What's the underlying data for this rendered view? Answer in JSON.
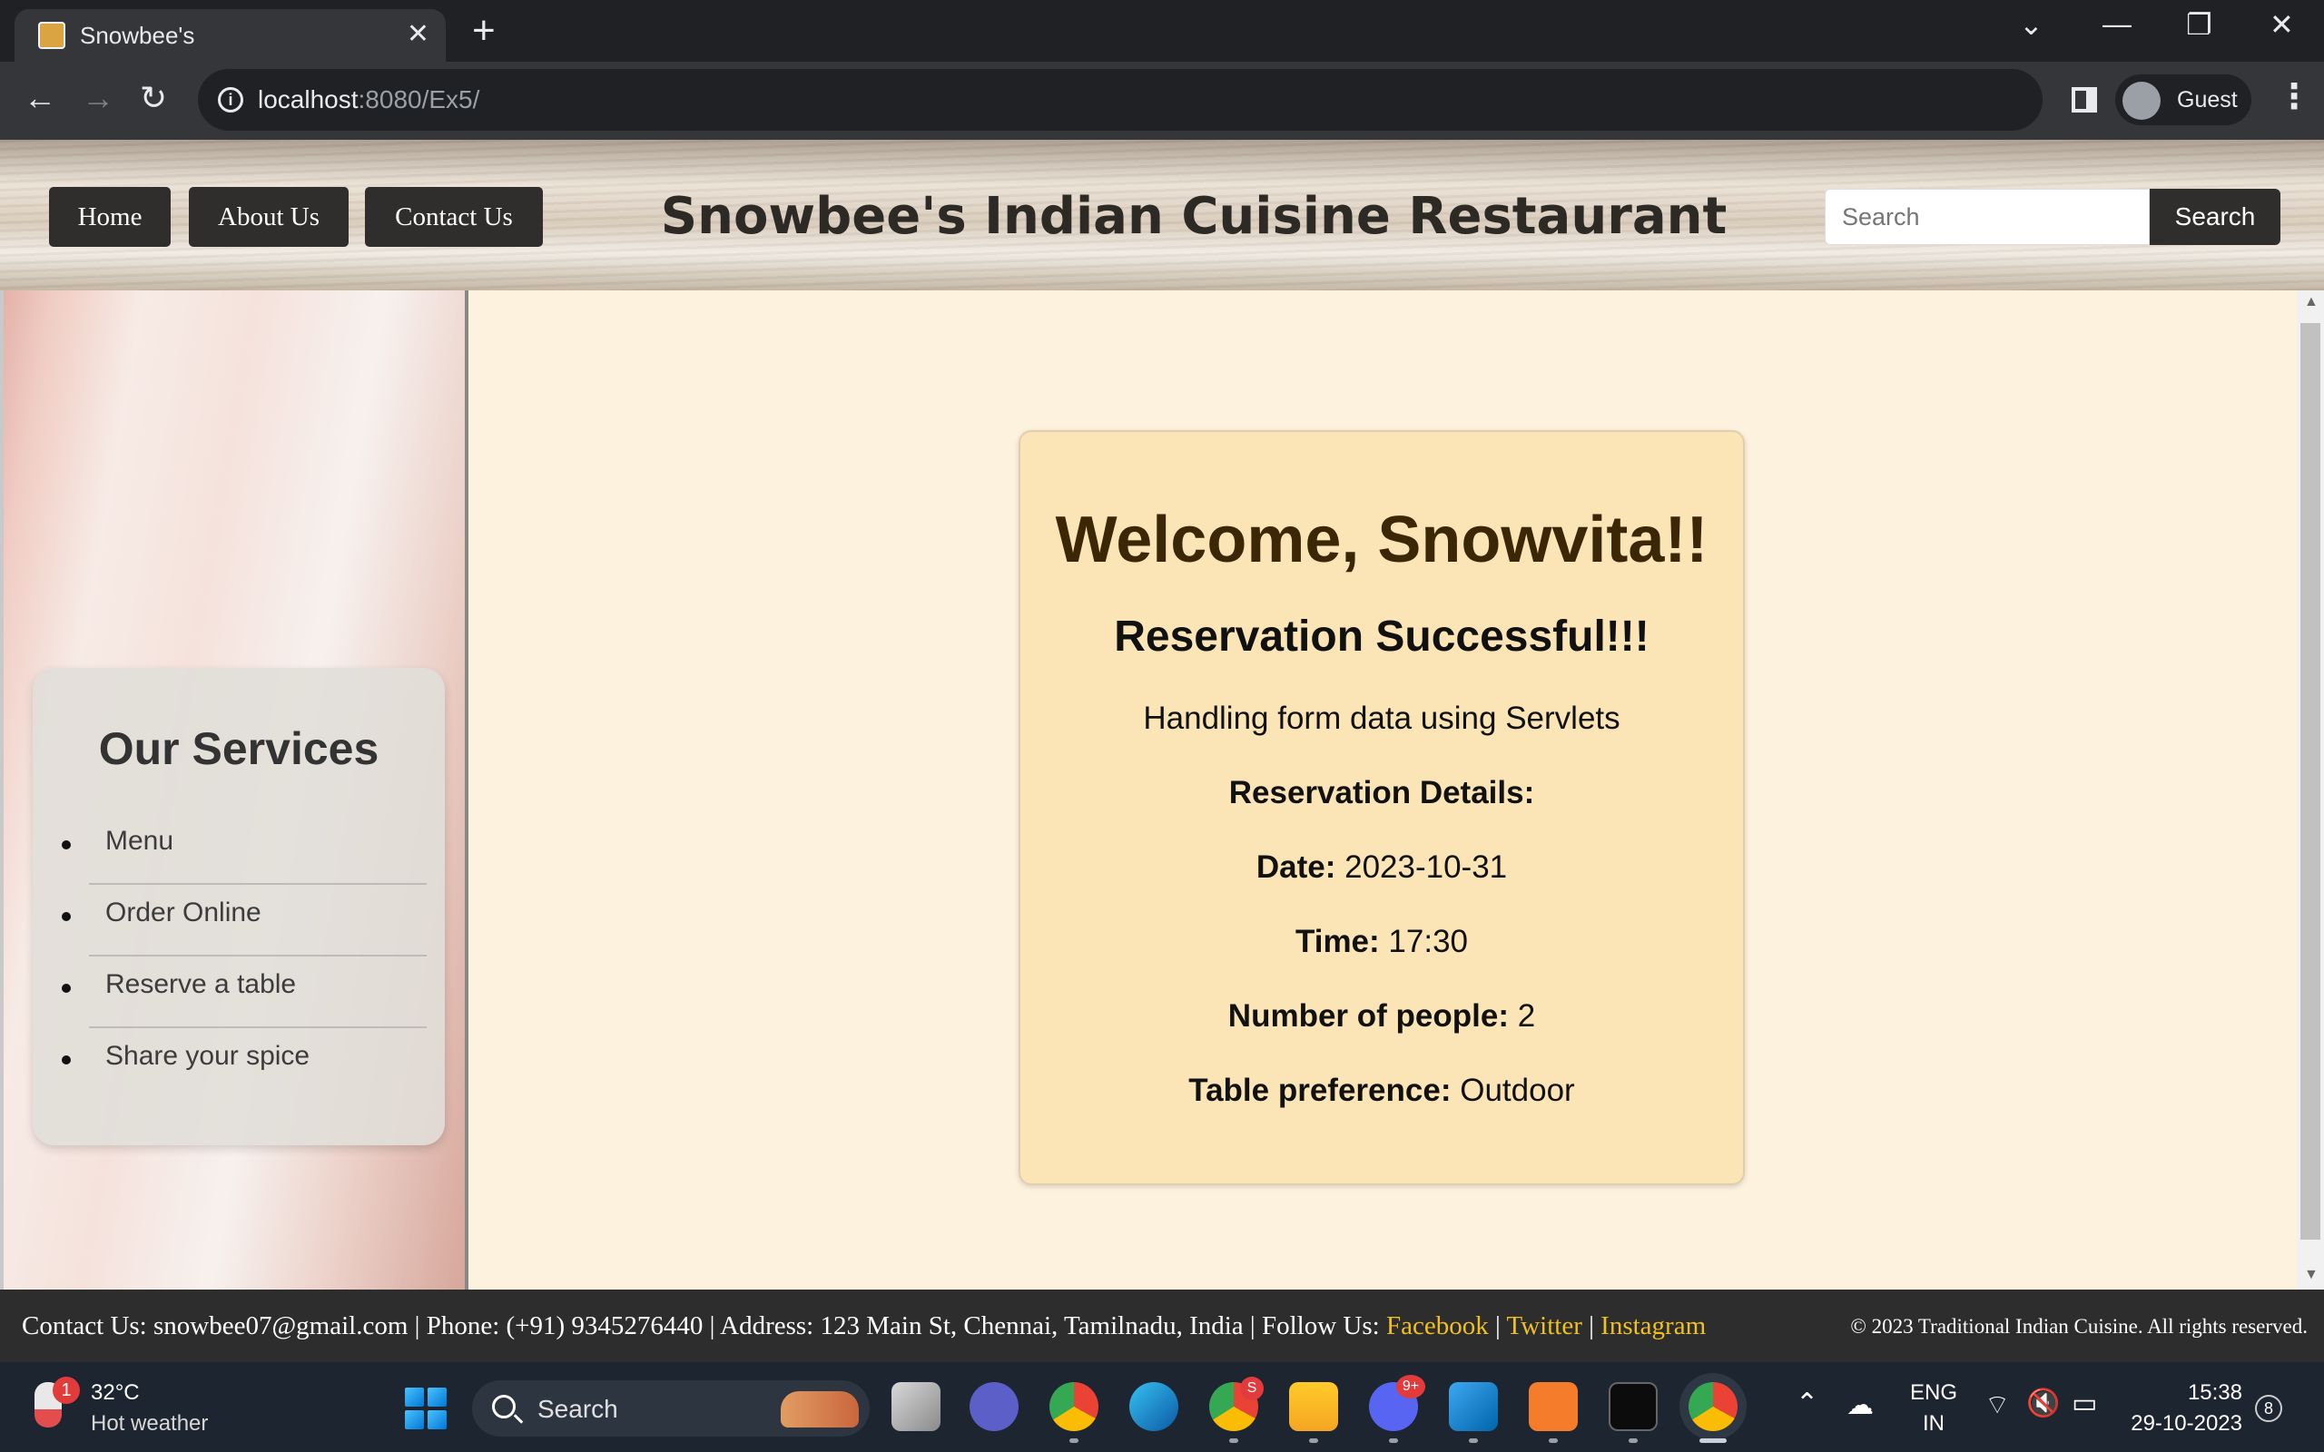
{
  "browser": {
    "tab_title": "Snowbee's",
    "url_host": "localhost",
    "url_path": ":8080/Ex5/",
    "profile_name": "Guest",
    "new_tab_glyph": "+",
    "close_glyph": "✕",
    "back_glyph": "←",
    "forward_glyph": "→",
    "reload_glyph": "↻",
    "menu_glyph": "⋮",
    "info_glyph": "i"
  },
  "header": {
    "nav": [
      "Home",
      "About Us",
      "Contact Us"
    ],
    "title": "Snowbee's Indian Cuisine Restaurant",
    "search_placeholder": "Search",
    "search_button": "Search"
  },
  "sidebar": {
    "title": "Our Services",
    "items": [
      "Menu",
      "Order Online",
      "Reserve a table",
      "Share your spice"
    ]
  },
  "reservation": {
    "welcome": "Welcome, Snowvita!!",
    "status": "Reservation Successful!!!",
    "subtitle": "Handling form data using Servlets",
    "details_heading": "Reservation Details:",
    "date_label": "Date:",
    "date_value": "2023-10-31",
    "time_label": "Time:",
    "time_value": "17:30",
    "people_label": "Number of people:",
    "people_value": "2",
    "table_label": "Table preference:",
    "table_value": "Outdoor"
  },
  "footer": {
    "contact": "Contact Us: snowbee07@gmail.com | Phone: (+91) 9345276440 | Address: 123 Main St, Chennai, Tamilnadu, India | Follow Us: ",
    "facebook": "Facebook",
    "twitter": "Twitter",
    "instagram": "Instagram",
    "separator": " | ",
    "copyright": "© 2023 Traditional Indian Cuisine. All rights reserved."
  },
  "taskbar": {
    "weather_temp": "32°C",
    "weather_desc": "Hot weather",
    "weather_badge": "1",
    "search_label": "Search",
    "chrome_badge": "S",
    "discord_badge": "9+",
    "lang_top": "ENG",
    "lang_bottom": "IN",
    "time": "15:38",
    "date": "29-10-2023",
    "notifications": "8"
  },
  "colors": {
    "header_button": "#2f2e2c",
    "card_bg": "#fbe5b7",
    "page_bg": "#fdf2de",
    "footer_bg": "#2d2d2d",
    "footer_link": "#f0c020",
    "welcome_text": "#3b2705"
  }
}
